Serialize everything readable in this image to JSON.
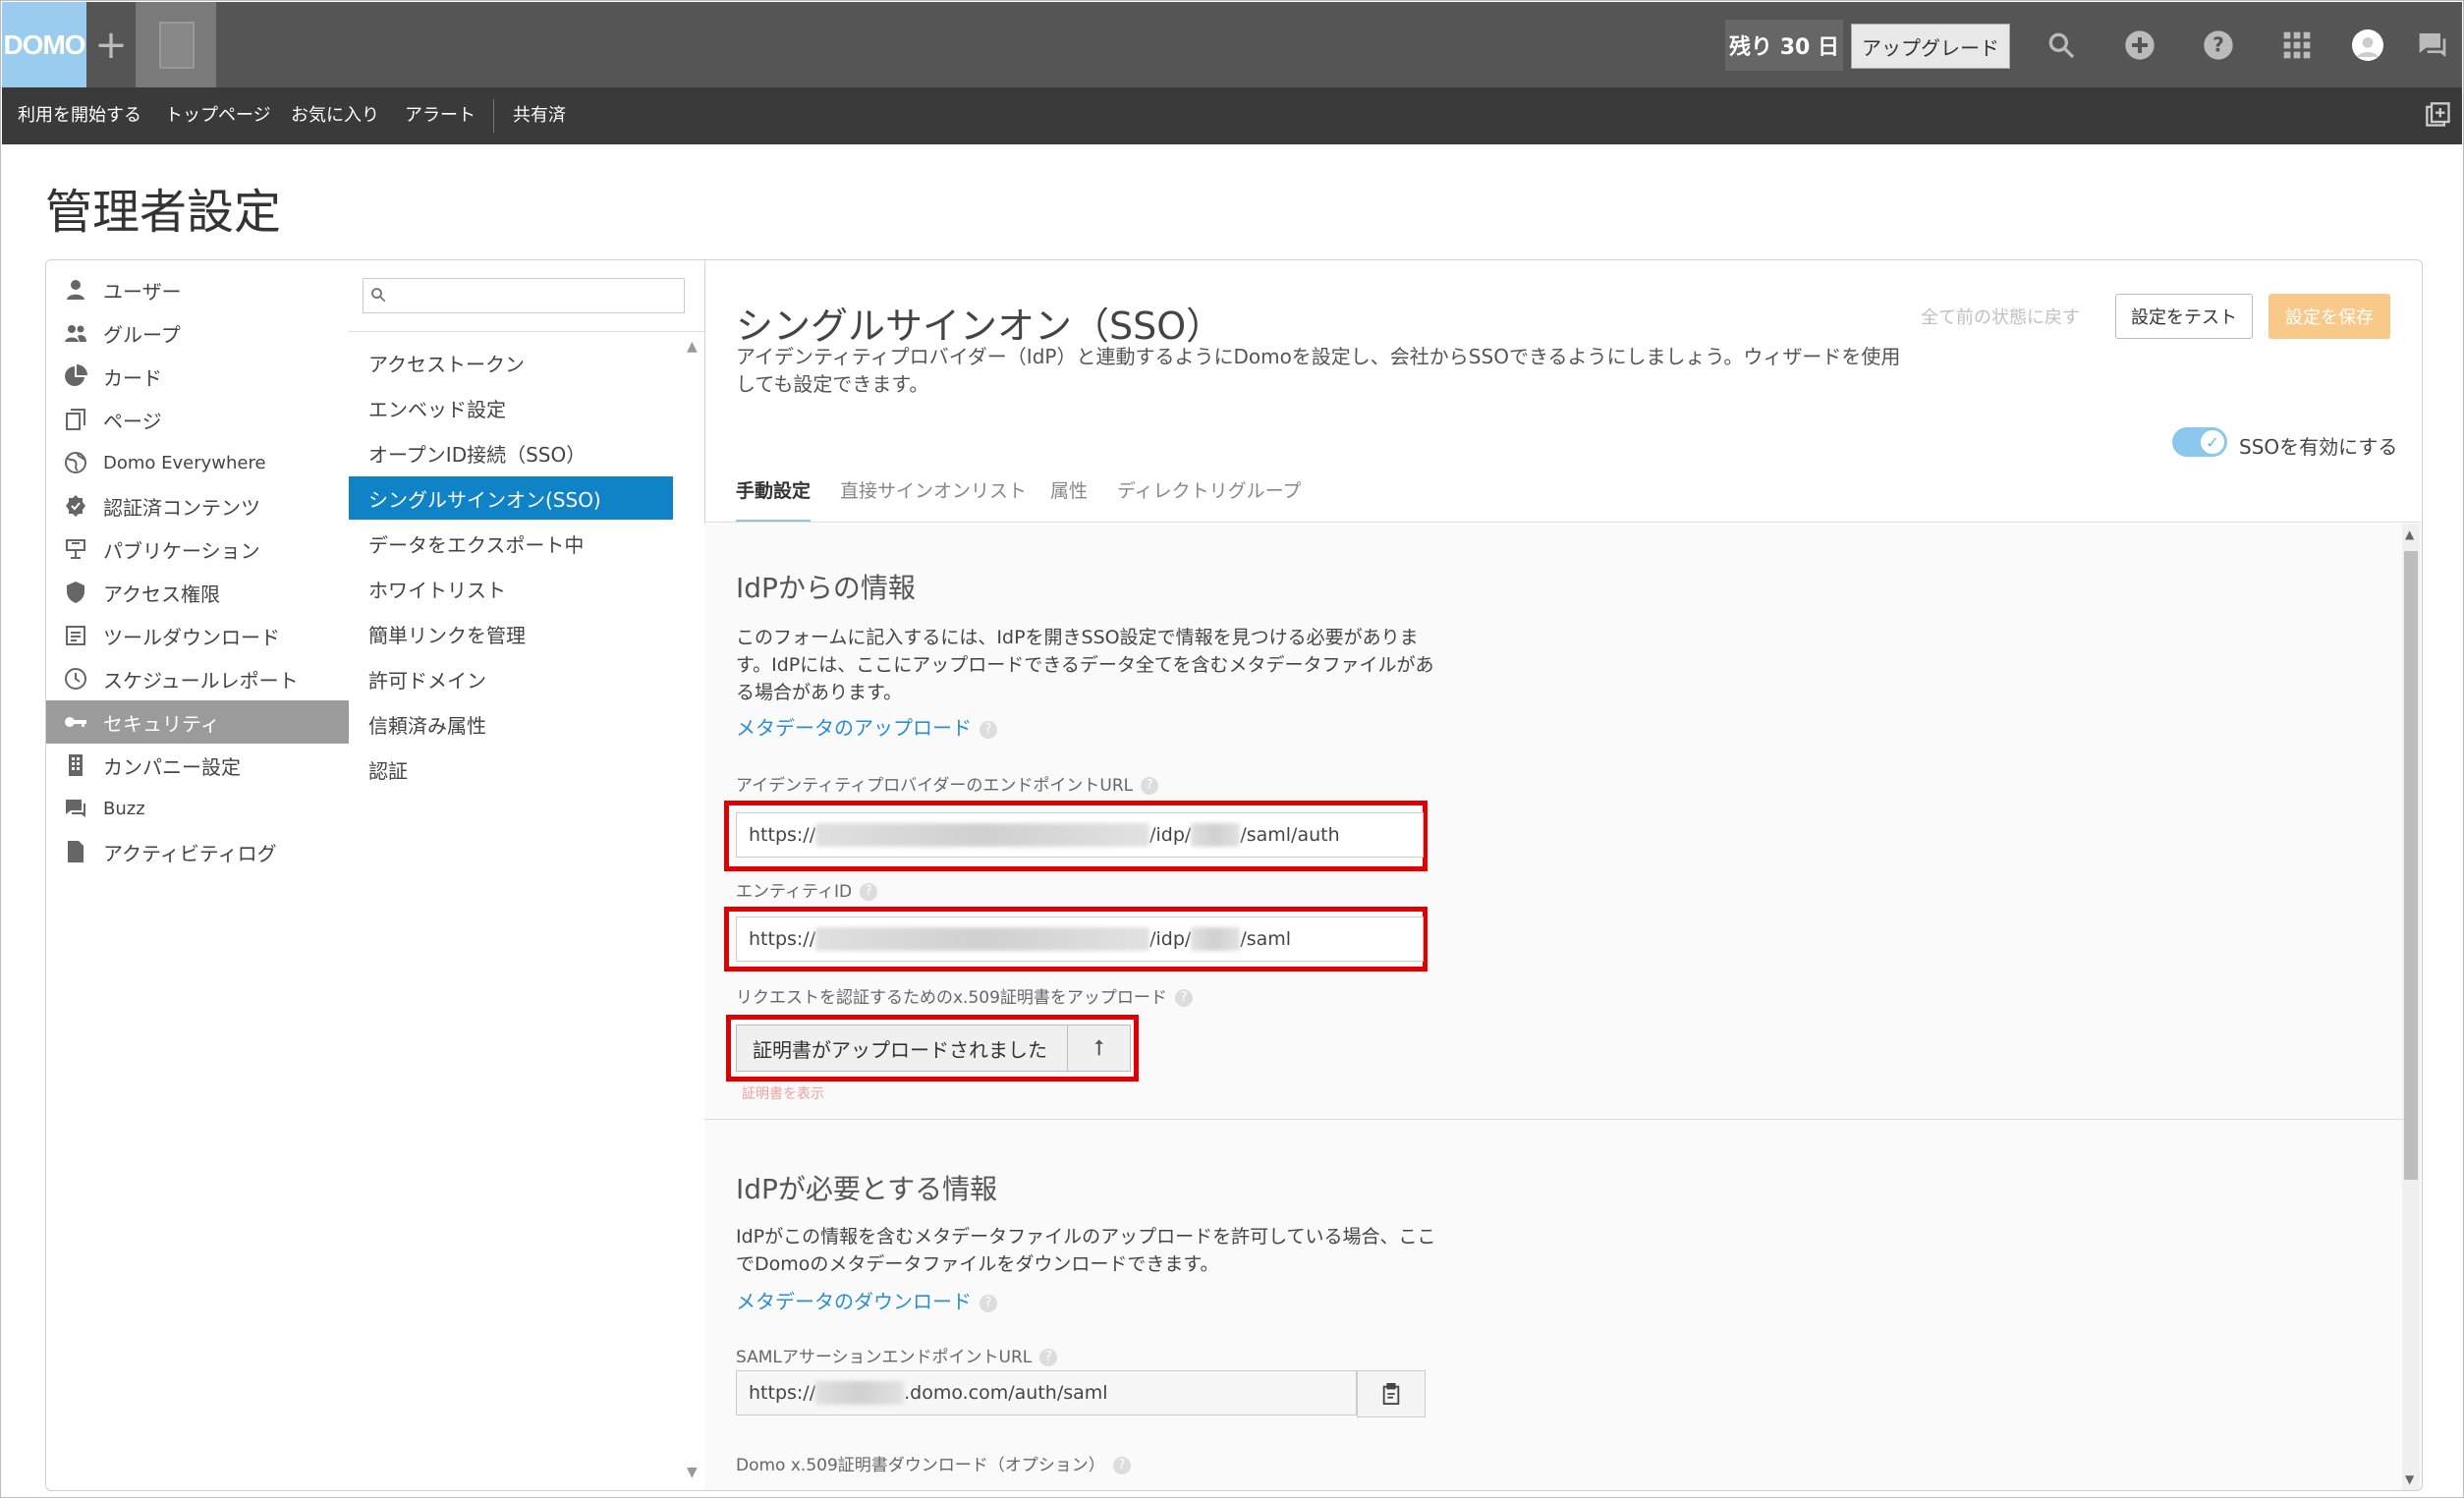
{
  "topbar": {
    "logo": "DOMO",
    "plus": "+",
    "trial": "残り 30 日",
    "upgrade": "アップグレード",
    "icons": [
      "search-icon",
      "add-icon",
      "help-icon",
      "apps-grid-icon",
      "avatar-icon",
      "chat-icon"
    ]
  },
  "nav": {
    "items": [
      "利用を開始する",
      "トップページ",
      "お気に入り",
      "アラート",
      "共有済"
    ]
  },
  "page": {
    "title": "管理者設定"
  },
  "sidebar": {
    "items": [
      {
        "label": "ユーザー",
        "icon": "user-icon"
      },
      {
        "label": "グループ",
        "icon": "group-icon"
      },
      {
        "label": "カード",
        "icon": "pie-icon"
      },
      {
        "label": "ページ",
        "icon": "pages-icon"
      },
      {
        "label": "Domo Everywhere",
        "icon": "globe-icon"
      },
      {
        "label": "認証済コンテンツ",
        "icon": "certified-icon"
      },
      {
        "label": "パブリケーション",
        "icon": "publication-icon"
      },
      {
        "label": "アクセス権限",
        "icon": "shield-icon"
      },
      {
        "label": "ツールダウンロード",
        "icon": "download-icon"
      },
      {
        "label": "スケジュールレポート",
        "icon": "clock-icon"
      },
      {
        "label": "セキュリティ",
        "icon": "key-icon",
        "active": true
      },
      {
        "label": "カンパニー設定",
        "icon": "building-icon"
      },
      {
        "label": "Buzz",
        "icon": "chat-icon"
      },
      {
        "label": "アクティビティログ",
        "icon": "document-icon"
      }
    ]
  },
  "midlist": {
    "search_placeholder": "",
    "items": [
      "アクセストークン",
      "エンベッド設定",
      "オープンID接続（SSO）",
      "シングルサインオン(SSO)",
      "データをエクスポート中",
      "ホワイトリスト",
      "簡単リンクを管理",
      "許可ドメイン",
      "信頼済み属性",
      "認証"
    ],
    "active_index": 3
  },
  "content": {
    "title": "シングルサインオン（SSO）",
    "description": "アイデンティティプロバイダー（IdP）と連動するようにDomoを設定し、会社からSSOできるようにしましょう。ウィザードを使用しても設定できます。",
    "reset": "全て前の状態に戻す",
    "test_button": "設定をテスト",
    "save_button": "設定を保存",
    "toggle_label": "SSOを有効にする",
    "toggle_on": true,
    "tabs": [
      "手動設定",
      "直接サインオンリスト",
      "属性",
      "ディレクトリグループ"
    ],
    "active_tab": 0
  },
  "idp_info": {
    "title": "IdPからの情報",
    "text": "このフォームに記入するには、IdPを開きSSO設定で情報を見つける必要があります。IdPには、ここにアップロードできるデータ全てを含むメタデータファイルがある場合があります。",
    "upload_link": "メタデータのアップロード",
    "endpoint_label": "アイデンティティプロバイダーのエンドポイントURL",
    "endpoint_prefix": "https://",
    "endpoint_mid": "/idp/",
    "endpoint_suffix": "/saml/auth",
    "entity_label": "エンティティID",
    "entity_prefix": "https://",
    "entity_mid": "/idp/",
    "entity_suffix": "/saml",
    "cert_label": "リクエストを認証するためのx.509証明書をアップロード",
    "cert_button": "証明書がアップロードされました",
    "cert_show": "証明書を表示"
  },
  "domo_info": {
    "title": "IdPが必要とする情報",
    "text": "IdPがこの情報を含むメタデータファイルのアップロードを許可している場合、ここでDomoのメタデータファイルをダウンロードできます。",
    "download_link": "メタデータのダウンロード",
    "saml_label": "SAMLアサーションエンドポイントURL",
    "saml_prefix": "https://",
    "saml_suffix": ".domo.com/auth/saml",
    "cert_download_label": "Domo x.509証明書ダウンロード（オプション）"
  },
  "colors": {
    "accent": "#0f83c6",
    "highlight_box": "#e00000",
    "save_disabled": "#f9c98a",
    "toggle": "#8cc8ee"
  }
}
